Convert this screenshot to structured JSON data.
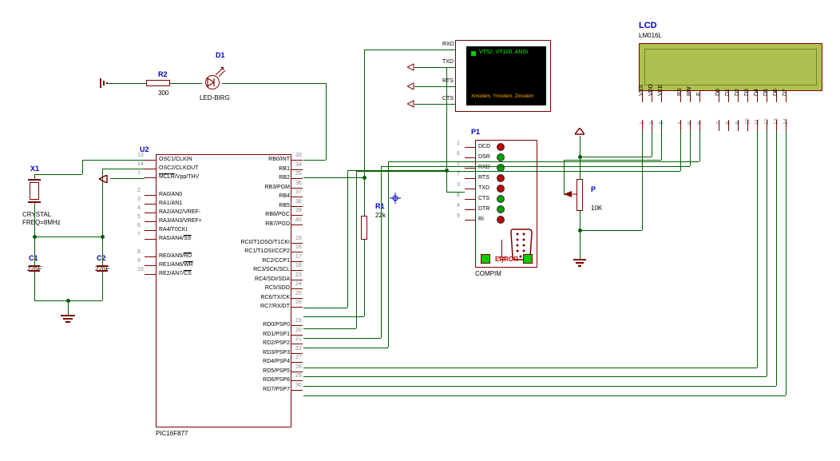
{
  "components": {
    "x1": {
      "ref": "X1",
      "type": "CRYSTAL",
      "freq": "FREQ=8MHz"
    },
    "c1": {
      "ref": "C1",
      "value": "22pF"
    },
    "c2": {
      "ref": "C2",
      "value": "22pF"
    },
    "r2": {
      "ref": "R2",
      "value": "300"
    },
    "r1": {
      "ref": "R1",
      "value": "22k"
    },
    "d1": {
      "ref": "D1",
      "type": "LED-BIRG"
    },
    "u2": {
      "ref": "U2",
      "part": "PIC16F877"
    },
    "p1": {
      "ref": "P1",
      "part": "COMPIM",
      "status": "ERROR"
    },
    "pot": {
      "ref": "P",
      "value": "10K"
    },
    "lcd": {
      "ref": "LCD",
      "part": "LM016L"
    },
    "terminal": {
      "line1": "VT52, VT100, ANSI",
      "line2": "Xmodem, Ymodem, Zmodem",
      "sig0": "RXD",
      "sig1": "TXD",
      "sig2": "RTS",
      "sig3": "CTS"
    }
  },
  "u2_left": [
    {
      "num": "13",
      "name": "OSC1/CLKIN"
    },
    {
      "num": "14",
      "name": "OSC2/CLKOUT"
    },
    {
      "num": "1",
      "name": "MCLR/Vpp/THV",
      "ov": "MCLR"
    },
    {
      "num": "",
      "name": ""
    },
    {
      "num": "2",
      "name": "RA0/AN0"
    },
    {
      "num": "3",
      "name": "RA1/AN1"
    },
    {
      "num": "4",
      "name": "RA2/AN2/VREF-"
    },
    {
      "num": "5",
      "name": "RA3/AN3/VREF+"
    },
    {
      "num": "6",
      "name": "RA4/T0CKI"
    },
    {
      "num": "7",
      "name": "RA5/AN4/SS",
      "ov": "SS"
    },
    {
      "num": "",
      "name": ""
    },
    {
      "num": "8",
      "name": "RE0/AN5/RD",
      "ov": "RD"
    },
    {
      "num": "9",
      "name": "RE1/AN6/WR",
      "ov": "WR"
    },
    {
      "num": "10",
      "name": "RE2/AN7/CS",
      "ov": "CS"
    }
  ],
  "u2_right": [
    {
      "num": "33",
      "name": "RB0/INT"
    },
    {
      "num": "34",
      "name": "RB1"
    },
    {
      "num": "35",
      "name": "RB2"
    },
    {
      "num": "36",
      "name": "RB3/PGM"
    },
    {
      "num": "37",
      "name": "RB4"
    },
    {
      "num": "38",
      "name": "RB5"
    },
    {
      "num": "39",
      "name": "RB6/PGC"
    },
    {
      "num": "40",
      "name": "RB7/PGD"
    },
    {
      "num": "",
      "name": ""
    },
    {
      "num": "15",
      "name": "RC0/T1OSO/T1CKI"
    },
    {
      "num": "16",
      "name": "RC1/T1OSI/CCP2"
    },
    {
      "num": "17",
      "name": "RC2/CCP1"
    },
    {
      "num": "18",
      "name": "RC3/SCK/SCL"
    },
    {
      "num": "23",
      "name": "RC4/SDI/SDA"
    },
    {
      "num": "24",
      "name": "RC5/SDO"
    },
    {
      "num": "25",
      "name": "RC6/TX/CK"
    },
    {
      "num": "26",
      "name": "RC7/RX/DT"
    },
    {
      "num": "",
      "name": ""
    },
    {
      "num": "19",
      "name": "RD0/PSP0"
    },
    {
      "num": "20",
      "name": "RD1/PSP1"
    },
    {
      "num": "21",
      "name": "RD2/PSP2"
    },
    {
      "num": "22",
      "name": "RD3/PSP3"
    },
    {
      "num": "27",
      "name": "RD4/PSP4"
    },
    {
      "num": "28",
      "name": "RD5/PSP5"
    },
    {
      "num": "29",
      "name": "RD6/PSP6"
    },
    {
      "num": "30",
      "name": "RD7/PSP7"
    }
  ],
  "compim_pins": [
    {
      "num": "1",
      "name": "DCD",
      "color": "#c00000"
    },
    {
      "num": "6",
      "name": "DSR",
      "color": "#00a000"
    },
    {
      "num": "2",
      "name": "RXD",
      "color": "#00a000"
    },
    {
      "num": "7",
      "name": "RTS",
      "color": "#c00000"
    },
    {
      "num": "3",
      "name": "TXD",
      "color": "#c00000"
    },
    {
      "num": "8",
      "name": "CTS",
      "color": "#00a000"
    },
    {
      "num": "4",
      "name": "DTR",
      "color": "#00a000"
    },
    {
      "num": "9",
      "name": "RI",
      "color": "#c00000"
    }
  ],
  "lcd_pins": [
    {
      "num": "1",
      "name": "VSS"
    },
    {
      "num": "2",
      "name": "VDD"
    },
    {
      "num": "3",
      "name": "VEE"
    },
    {
      "num": "4",
      "name": "RS"
    },
    {
      "num": "5",
      "name": "RW"
    },
    {
      "num": "6",
      "name": "E"
    },
    {
      "num": "7",
      "name": "D0"
    },
    {
      "num": "8",
      "name": "D1"
    },
    {
      "num": "9",
      "name": "D2"
    },
    {
      "num": "10",
      "name": "D3"
    },
    {
      "num": "11",
      "name": "D4"
    },
    {
      "num": "12",
      "name": "D5"
    },
    {
      "num": "13",
      "name": "D6"
    },
    {
      "num": "14",
      "name": "D7"
    }
  ]
}
